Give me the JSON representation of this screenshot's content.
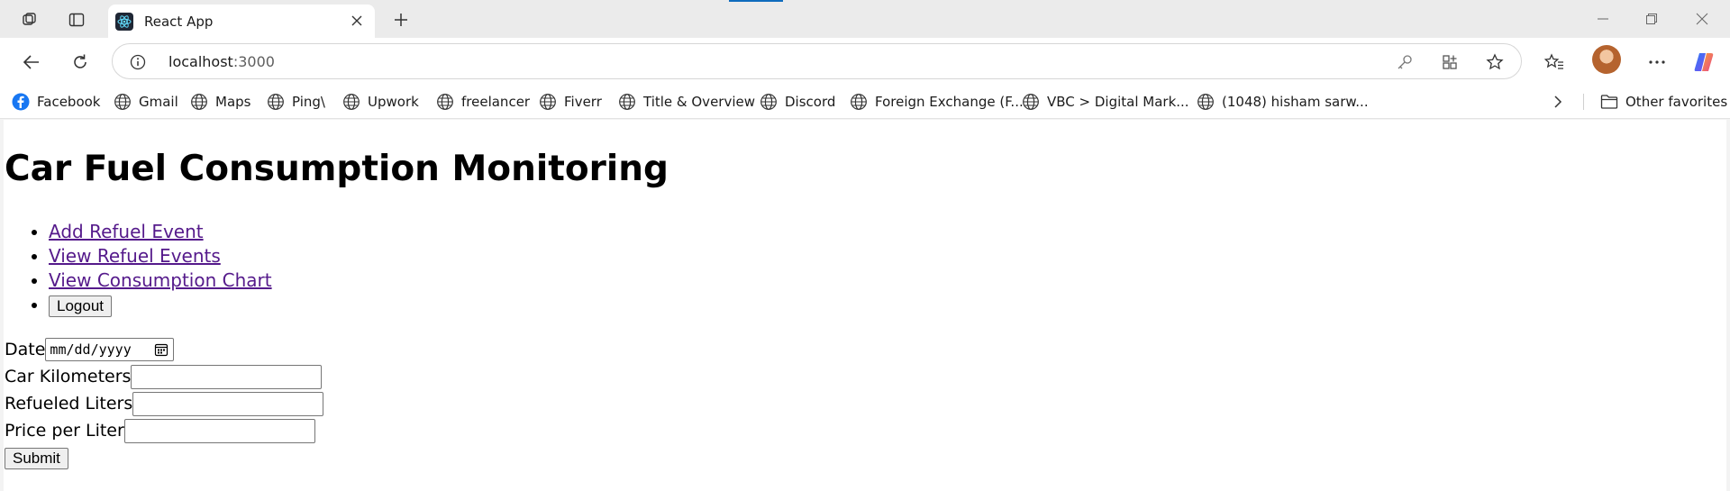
{
  "browser": {
    "tab": {
      "title": "React App"
    },
    "address": {
      "host": "localhost",
      "port": ":3000"
    },
    "bookmarks": [
      {
        "label": "Facebook",
        "icon": "facebook-icon"
      },
      {
        "label": "Gmail",
        "icon": "globe-icon"
      },
      {
        "label": "Maps",
        "icon": "globe-icon"
      },
      {
        "label": "Ping\\",
        "icon": "globe-icon"
      },
      {
        "label": "Upwork",
        "icon": "globe-icon"
      },
      {
        "label": "freelancer",
        "icon": "globe-icon"
      },
      {
        "label": "Fiverr",
        "icon": "globe-icon"
      },
      {
        "label": "Title & Overview",
        "icon": "globe-icon"
      },
      {
        "label": "Discord",
        "icon": "globe-icon"
      },
      {
        "label": "Foreign Exchange (F...",
        "icon": "globe-icon"
      },
      {
        "label": "VBC > Digital Mark...",
        "icon": "globe-icon"
      },
      {
        "label": "(1048) hisham sarw...",
        "icon": "globe-icon"
      }
    ],
    "other_favorites": "Other favorites"
  },
  "page": {
    "title": "Car Fuel Consumption Monitoring",
    "nav": {
      "add_refuel": "Add Refuel Event",
      "view_refuel": "View Refuel Events",
      "view_chart": "View Consumption Chart",
      "logout": "Logout"
    },
    "form": {
      "date_label": "Date",
      "date_placeholder": "mm/dd/yyyy",
      "km_label": "Car Kilometers",
      "liters_label": "Refueled Liters",
      "price_label": "Price per Liter",
      "submit": "Submit"
    }
  },
  "colors": {
    "link": "#551a8b",
    "accent": "#0f6cbd"
  }
}
